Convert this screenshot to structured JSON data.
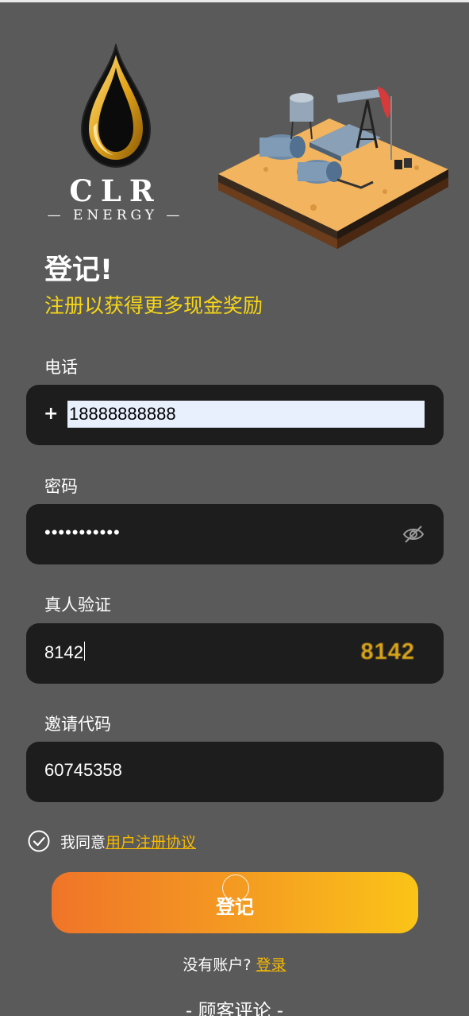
{
  "brand": {
    "name": "CLR",
    "sub": "— ENERGY —"
  },
  "header": {
    "title": "登记!",
    "subtitle": "注册以获得更多现金奖励"
  },
  "form": {
    "phone": {
      "label": "电话",
      "prefix": "+",
      "value": "18888888888"
    },
    "password": {
      "label": "密码",
      "masked_value": "•••••••••••",
      "visibility_icon": "eye-off-icon"
    },
    "captcha": {
      "label": "真人验证",
      "value": "8142",
      "code": "8142"
    },
    "invite": {
      "label": "邀请代码",
      "value": "60745358"
    },
    "agreement": {
      "text": "我同意",
      "link": "用户注册协议",
      "checked": true
    },
    "submit_label": "登记"
  },
  "footer": {
    "no_account": "没有账户?",
    "login_link": "登录",
    "reviews_title": "- 顾客评论 -"
  },
  "colors": {
    "background": "#5a5a5a",
    "field": "#1d1d1d",
    "accent_yellow": "#f7d716",
    "link": "#f7b900",
    "button_start": "#f07428",
    "button_end": "#fbc418"
  }
}
